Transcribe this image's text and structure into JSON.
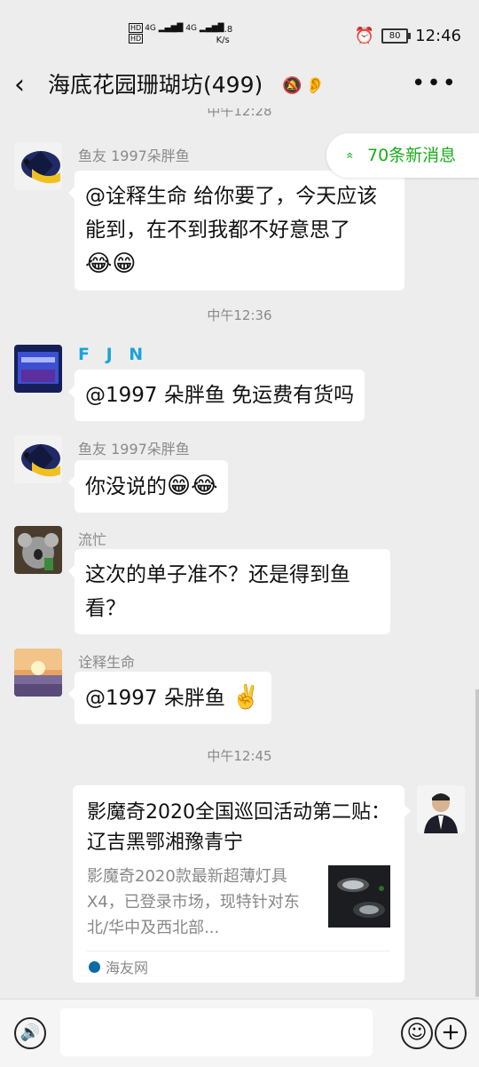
{
  "status": {
    "hd1": "HD",
    "hd2": "HD",
    "net1": "4G",
    "net2": "4G",
    "speed_value": "13.8",
    "speed_unit": "K/s",
    "battery": "80",
    "clock": "12:46",
    "alarm_icon": "alarm-icon"
  },
  "header": {
    "back_icon": "‹",
    "title": "海底花园珊瑚坊(499)",
    "more": "•••"
  },
  "new_messages": {
    "chevron": "»",
    "label": "70条新消息"
  },
  "messages": [
    {
      "time": "中午12:28"
    },
    {
      "sender": "鱼友 1997朵胖鱼",
      "text": "@诠释生命  给你要了，今天应该能到，在不到我都不好意思了",
      "emoji": "😂😁"
    },
    {
      "time": "中午12:36"
    },
    {
      "sender": "F J N",
      "text": "@1997 朵胖鱼  免运费有货吗"
    },
    {
      "sender": "鱼友 1997朵胖鱼",
      "text": "你没说的",
      "emoji": "😁😂"
    },
    {
      "sender": "流忙",
      "text": "这次的单子准不？还是得到鱼看？"
    },
    {
      "sender": "诠释生命",
      "text": "@1997 朵胖鱼",
      "emoji": "✌️"
    },
    {
      "time": "中午12:45"
    }
  ],
  "card": {
    "title": "影魔奇2020全国巡回活动第二贴：  辽吉黑鄂湘豫青宁",
    "desc": "影魔奇2020款最新超薄灯具X4，已登录市场，现特针对东北/华中及西北部...",
    "source": "海友网"
  },
  "input": {
    "placeholder": ""
  },
  "colors": {
    "accent": "#1aad19",
    "fjn": "#1aa3d9",
    "bg": "#ededed"
  }
}
